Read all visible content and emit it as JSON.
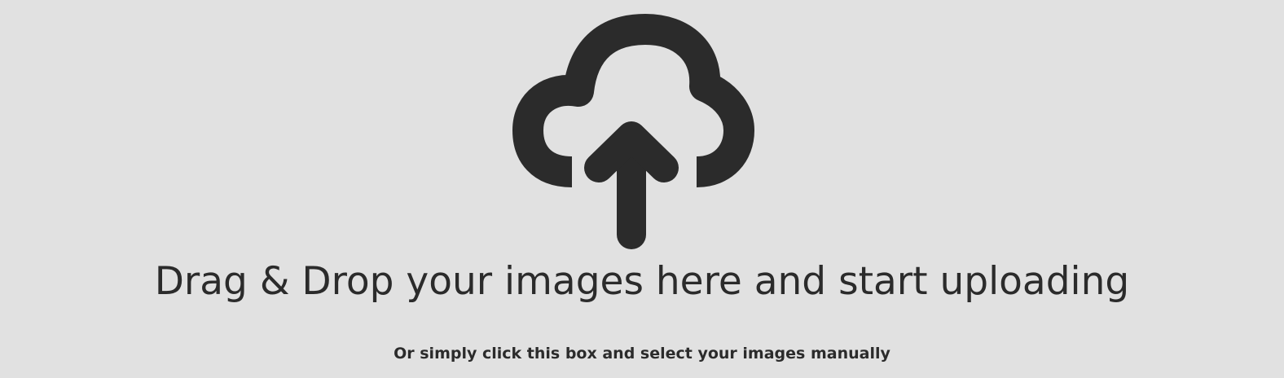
{
  "dropzone": {
    "icon": "cloud-upload-icon",
    "title": "Drag & Drop your images here and start uploading",
    "subtitle": "Or simply click this box and select your images manually"
  },
  "colors": {
    "background": "#e1e1e1",
    "foreground": "#2b2b2b"
  }
}
